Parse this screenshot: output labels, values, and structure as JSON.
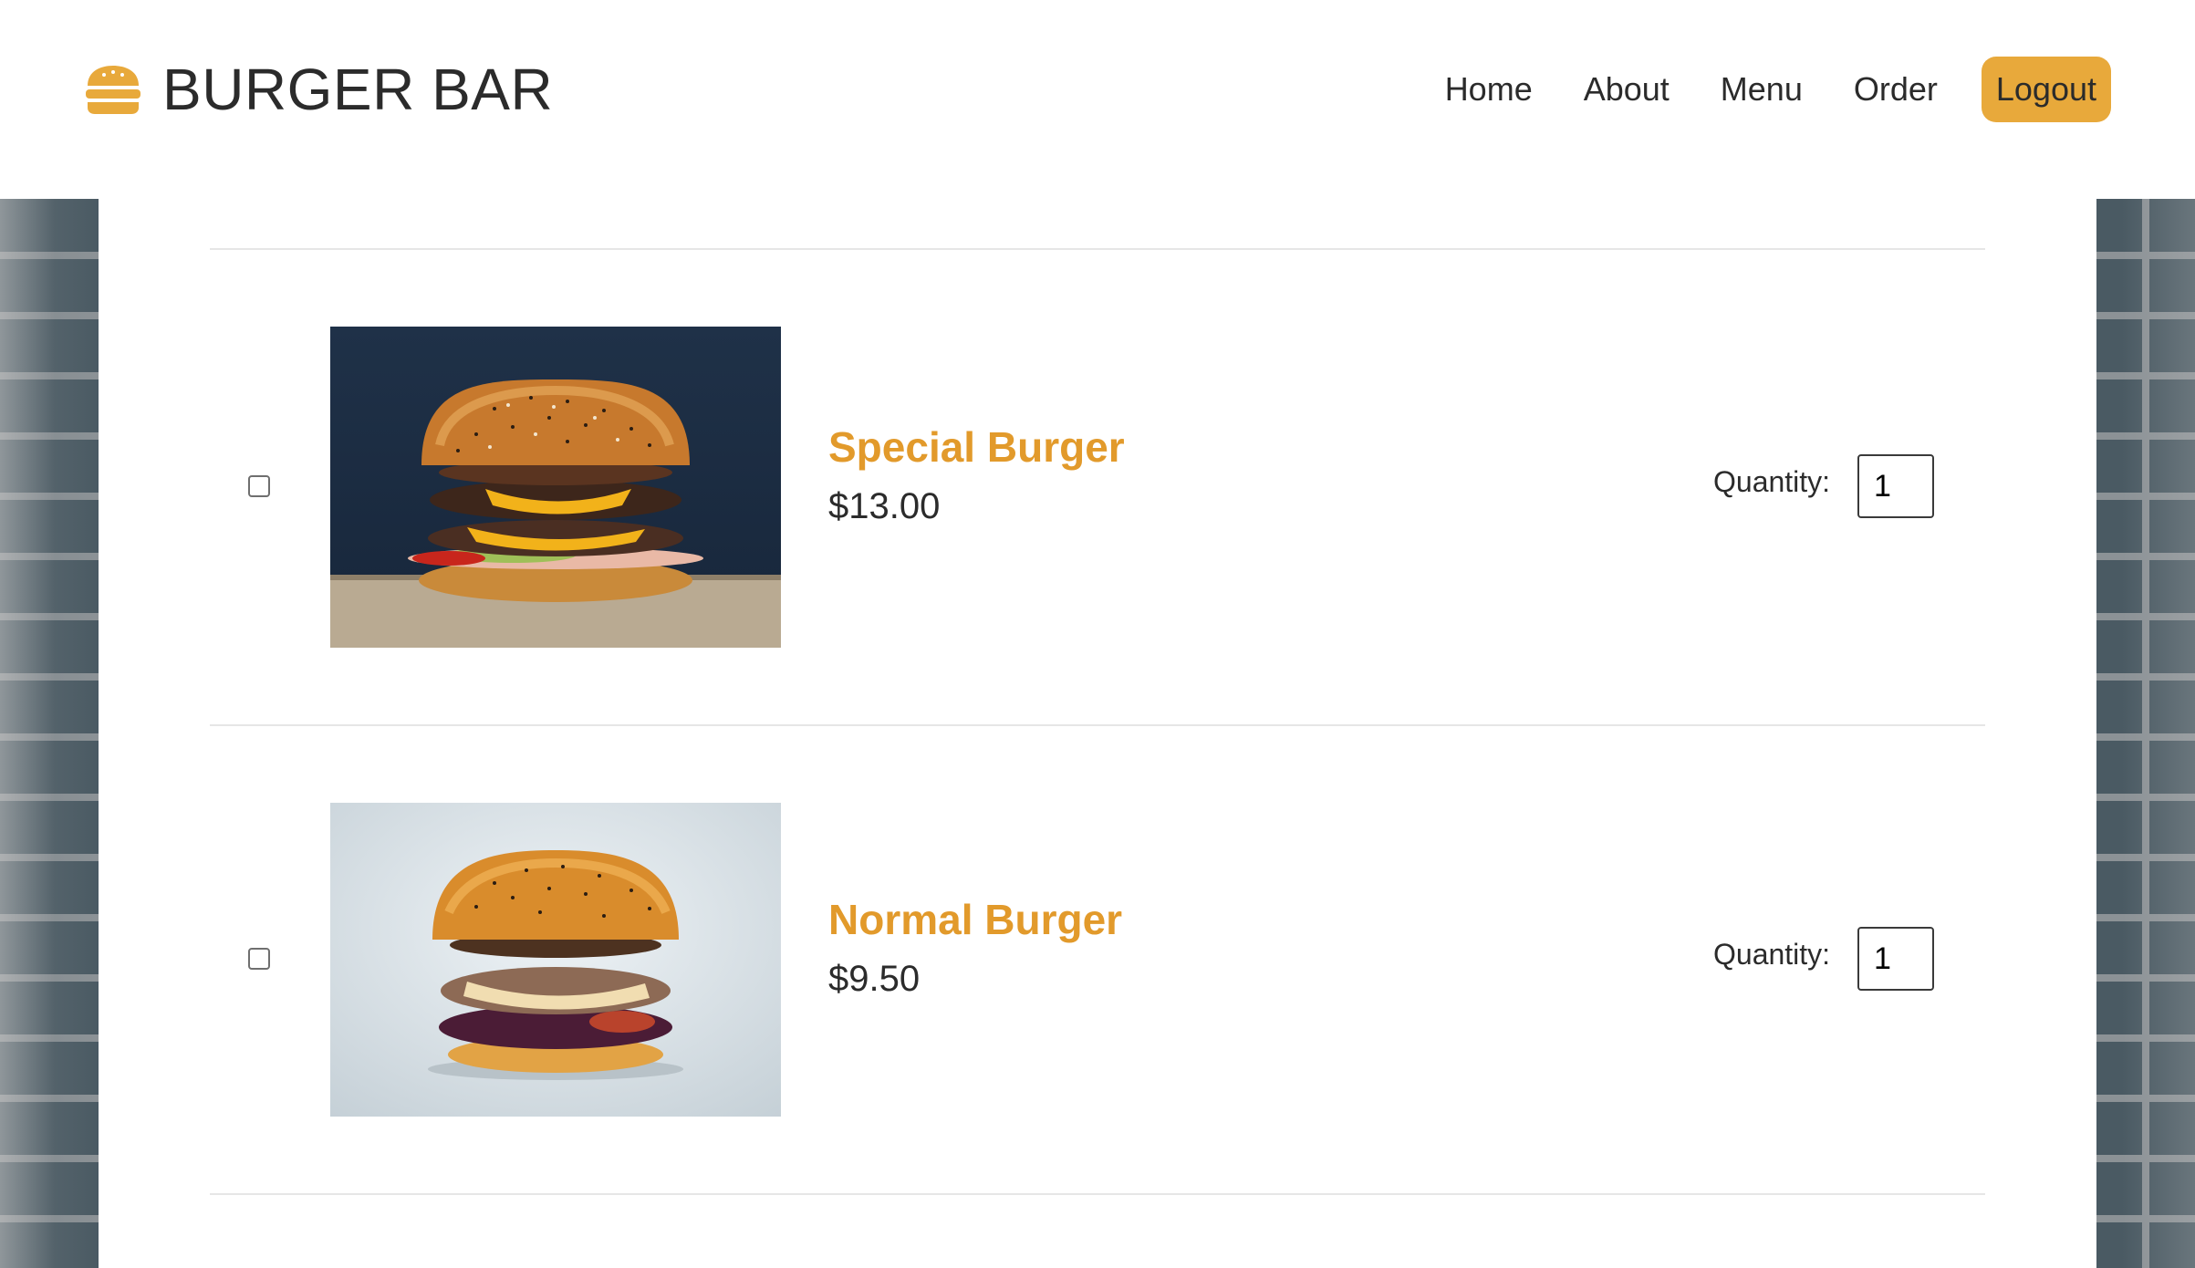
{
  "brand": {
    "name": "BURGER BAR",
    "icon": "burger-icon",
    "accent_color": "#e8a93b"
  },
  "nav": {
    "items": [
      {
        "label": "Home"
      },
      {
        "label": "About"
      },
      {
        "label": "Menu"
      },
      {
        "label": "Order"
      }
    ],
    "logout_label": "Logout"
  },
  "menu_items": [
    {
      "name": "Special Burger",
      "price": "$13.00",
      "quantity_label": "Quantity:",
      "quantity_value": "1",
      "checked": false
    },
    {
      "name": "Normal Burger",
      "price": "$9.50",
      "quantity_label": "Quantity:",
      "quantity_value": "1",
      "checked": false
    }
  ],
  "colors": {
    "item_name": "#e29a2b",
    "text": "#2b2b2b"
  }
}
